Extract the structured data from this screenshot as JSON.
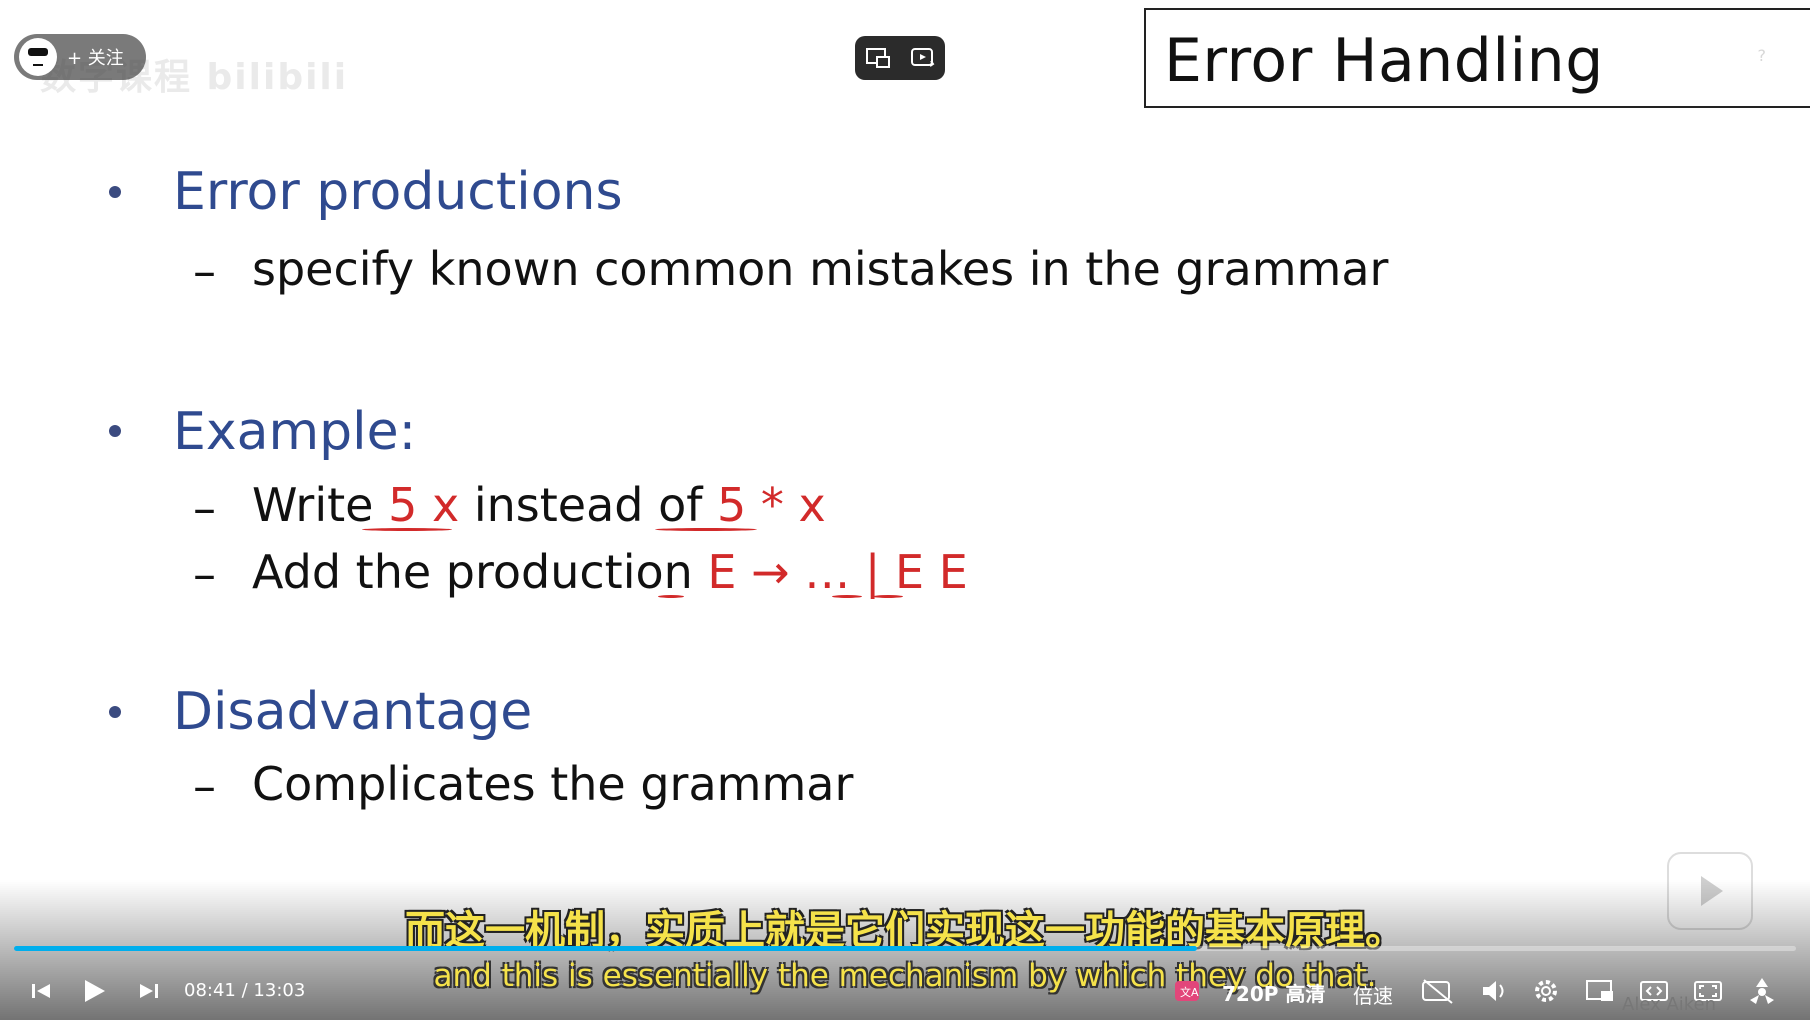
{
  "player": {
    "follow_label": "+ 关注",
    "watermark": "数字课程 bilibili",
    "time_current": "08:41",
    "time_separator": "/",
    "time_total": "13:03",
    "progress_fraction": 0.664,
    "quality_label": "720P 高清",
    "speed_label": "倍速",
    "accent_color": "#00aeec",
    "subtitle_color": "#f5e24a"
  },
  "slide": {
    "title": "Error Handling",
    "help_mark": "?",
    "author": "Alex Aiken",
    "bullets": [
      {
        "heading": "Error productions",
        "sub": [
          "specify known common mistakes in the grammar"
        ]
      },
      {
        "heading": "Example:",
        "sub": []
      },
      {
        "heading": "Disadvantage",
        "sub": [
          "Complicates the grammar"
        ]
      }
    ],
    "example_line1": {
      "prefix": "Write ",
      "red1": "5 x",
      "middle": " instead of ",
      "red2": "5 * x"
    },
    "example_line2": {
      "prefix": "Add the production ",
      "red": "E → … | E E"
    },
    "dash": "–"
  },
  "subtitles": {
    "zh": "而这一机制，实质上就是它们实现这一功能的基本原理。",
    "en": "and this is essentially the mechanism by which they do that."
  },
  "icons": [
    "prev-icon",
    "play-icon",
    "next-icon",
    "subtitle-translate-icon",
    "danmaku-off-icon",
    "volume-icon",
    "settings-icon",
    "pip-icon",
    "widescreen-icon",
    "fullscreen-icon",
    "share-icon"
  ]
}
